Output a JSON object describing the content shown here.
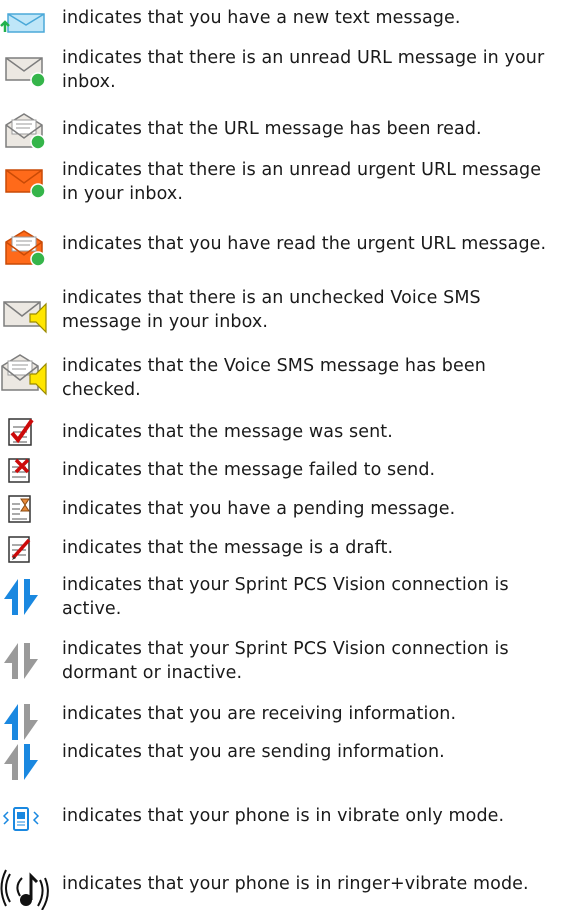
{
  "icon_list": [
    {
      "icon": "new-text-message-icon",
      "text": "indicates that you have a new text message."
    },
    {
      "icon": "unread-url-message-icon",
      "text": "indicates that there is an unread URL message in your inbox."
    },
    {
      "icon": "read-url-message-icon",
      "text": "indicates that the URL message has been read."
    },
    {
      "icon": "unread-urgent-url-message-icon",
      "text": "indicates that there is an unread urgent URL message in your inbox."
    },
    {
      "icon": "read-urgent-url-message-icon",
      "text": "indicates that you have read the urgent URL message."
    },
    {
      "icon": "unchecked-voice-sms-icon",
      "text": "indicates that there is an unchecked Voice SMS message in your inbox."
    },
    {
      "icon": "checked-voice-sms-icon",
      "text": "indicates that the Voice SMS message has been checked."
    },
    {
      "icon": "message-sent-icon",
      "text": "indicates that the message was sent."
    },
    {
      "icon": "message-failed-icon",
      "text": "indicates that the message failed to send."
    },
    {
      "icon": "message-pending-icon",
      "text": "indicates that you have a pending message."
    },
    {
      "icon": "message-draft-icon",
      "text": "indicates that the message is a draft."
    },
    {
      "icon": "vision-active-icon",
      "text": "indicates that your Sprint PCS Vision connection is active."
    },
    {
      "icon": "vision-dormant-icon",
      "text": "indicates that your Sprint PCS Vision connection is dormant or inactive."
    },
    {
      "icon": "receiving-data-icon",
      "text": "indicates that you are receiving information."
    },
    {
      "icon": "sending-data-icon",
      "text": "indicates that you are sending information."
    },
    {
      "icon": "vibrate-only-icon",
      "text": "indicates that your phone is in vibrate only mode."
    },
    {
      "icon": "ringer-vibrate-icon",
      "text": "indicates that your phone is in ringer+vibrate  mode."
    }
  ]
}
